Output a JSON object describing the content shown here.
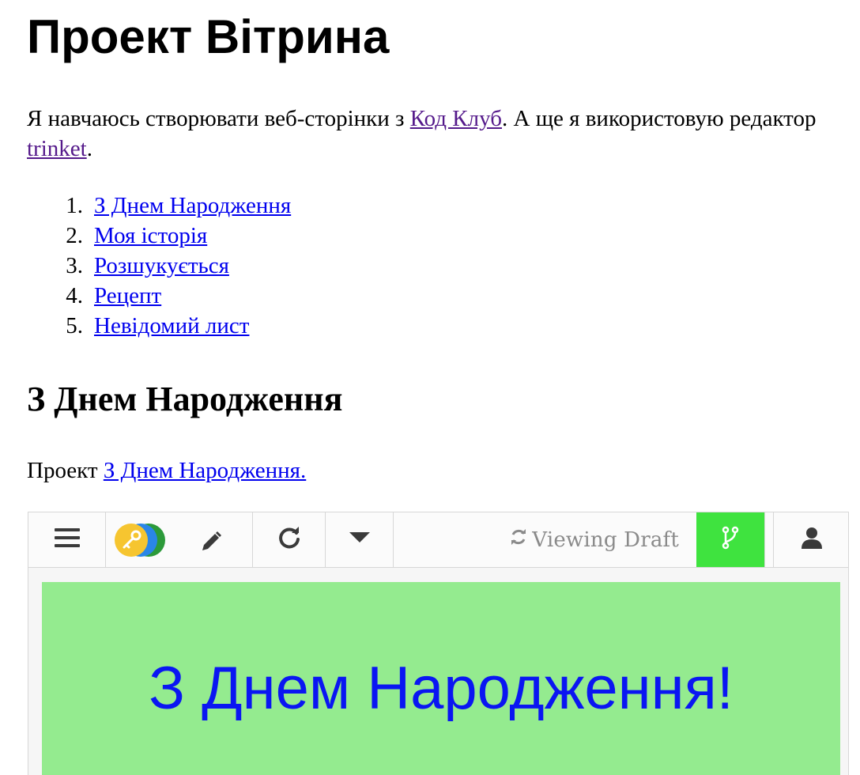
{
  "page": {
    "title": "Проект Вітрина",
    "intro": {
      "before": "Я навчаюсь створювати веб-сторінки з ",
      "link1": "Код Клуб",
      "middle": ". А ще я використовую редактор ",
      "link2": "trinket",
      "after": "."
    },
    "toc": [
      {
        "num": "1.",
        "label": "З Днем Народження"
      },
      {
        "num": "2.",
        "label": "Моя історія"
      },
      {
        "num": "3.",
        "label": "Розшукується"
      },
      {
        "num": "4.",
        "label": "Рецепт"
      },
      {
        "num": "5.",
        "label": "Невідомий лист"
      }
    ],
    "section_title": "З Днем Народження",
    "section_para": {
      "before": "Проект ",
      "link": "З Днем Народження."
    }
  },
  "trinket": {
    "toolbar": {
      "menu_icon": "hamburger-menu-icon",
      "logo_icon": "trinket-key-logo-icon",
      "edit_icon": "pencil-icon",
      "reload_icon": "reload-icon",
      "dropdown_icon": "caret-down-icon",
      "status_icon": "refresh-icon",
      "status_text": "Viewing Draft",
      "branch_icon": "code-branch-icon",
      "user_icon": "user-icon",
      "branch_color": "#3fe33f"
    },
    "output": {
      "heading": "З Днем Народження!",
      "background": "#94eb8f",
      "heading_color": "#0a16f2"
    }
  }
}
